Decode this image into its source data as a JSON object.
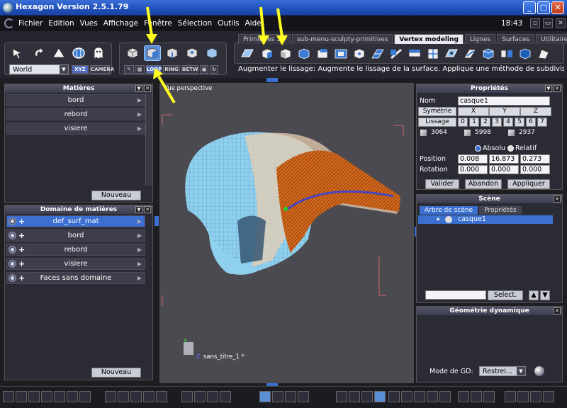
{
  "window": {
    "title": "Hexagon Version 2.5.1.79",
    "min": "_",
    "max": "□",
    "close": "✕"
  },
  "menu": {
    "items": [
      "Fichier",
      "Edition",
      "Vues",
      "Affichage",
      "Fenêtre",
      "Sélection",
      "Outils",
      "Aide"
    ],
    "clock": "18:43"
  },
  "toolbar": {
    "world_select": "World",
    "xyz_label": "XYZ",
    "camera_label": "CAMERA",
    "loop_label": "LOOP",
    "ring_label": "RING",
    "betw_label": "BETW"
  },
  "tabs": [
    {
      "label": "Primitives 3D",
      "active": false
    },
    {
      "label": "sub-menu-sculpty-primitives",
      "active": false
    },
    {
      "label": "Vertex modeling",
      "active": true
    },
    {
      "label": "Lignes",
      "active": false
    },
    {
      "label": "Surfaces",
      "active": false
    },
    {
      "label": "Utilitaires",
      "active": false
    }
  ],
  "status_text": "Augmenter le lissage: Augmente le lissage de la surface. Applique une méthode de subdivision",
  "materials_panel": {
    "title": "Matières",
    "items": [
      "bord",
      "rebord",
      "visiere"
    ],
    "new_button": "Nouveau"
  },
  "domain_panel": {
    "title": "Domaine de matières",
    "items": [
      {
        "label": "def_surf_mat",
        "selected": true
      },
      {
        "label": "bord",
        "selected": false
      },
      {
        "label": "rebord",
        "selected": false
      },
      {
        "label": "visiere",
        "selected": false
      },
      {
        "label": "Faces sans domaine",
        "selected": false
      }
    ],
    "new_button": "Nouveau"
  },
  "viewport": {
    "label": "Vue perspective",
    "file_name": "sans_titre_1 *",
    "axis_y": "Y",
    "axis_z": "Z"
  },
  "properties": {
    "title": "Propriétés",
    "name_label": "Nom",
    "name_value": "casque1",
    "symmetry_label": "Symétrie",
    "axes": [
      "X",
      "Y",
      "Z"
    ],
    "smoothing_label": "Lissage",
    "smoothing_levels": [
      "0",
      "1",
      "2",
      "3",
      "4",
      "5",
      "6",
      "7"
    ],
    "stats": [
      "3064",
      "5998",
      "2937"
    ],
    "absolu_label": "Absolu",
    "relatif_label": "Relatif",
    "position_label": "Position",
    "position": [
      "0.008",
      "16.873",
      "0.273"
    ],
    "rotation_label": "Rotation",
    "rotation": [
      "0.000",
      "0.000",
      "0.000"
    ],
    "validate_button": "Valider",
    "abandon_button": "Abandon",
    "apply_button": "Appliquer"
  },
  "scene": {
    "title": "Scène",
    "tab_tree": "Arbre de scène",
    "tab_props": "Propriétés",
    "item": "casque1",
    "select_button": "Select."
  },
  "dyngeo": {
    "title": "Géométrie dynamique",
    "mode_label": "Mode de GD:",
    "mode_value": "Restrei..."
  },
  "colors": {
    "accent": "#3b6fd0",
    "helmet": "#8fd0ee",
    "visor": "#d2691e",
    "arrow": "#ffff22"
  }
}
